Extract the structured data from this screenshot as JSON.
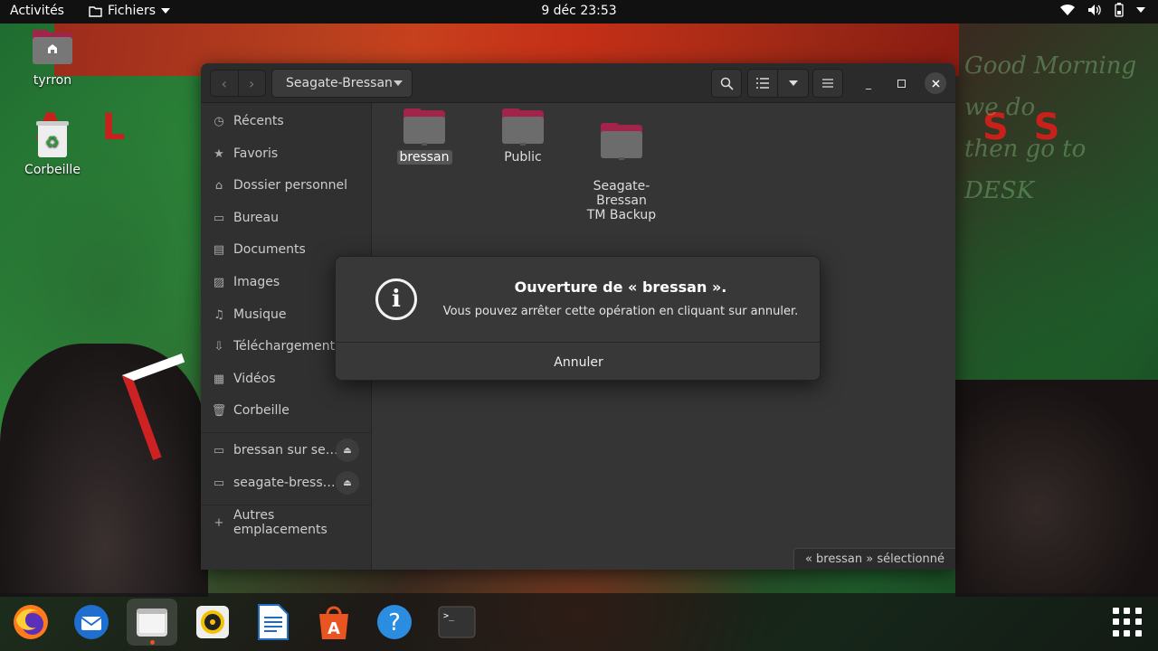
{
  "topbar": {
    "activities": "Activités",
    "app_menu": "Fichiers",
    "clock": "9 déc  23:53",
    "icons": [
      "wifi-icon",
      "volume-icon",
      "battery-icon",
      "system-menu-chevron-icon"
    ]
  },
  "desktop": {
    "icons": [
      {
        "label": "tyrron",
        "icon": "home-folder-icon"
      },
      {
        "label": "Corbeille",
        "icon": "trash-icon"
      }
    ]
  },
  "window": {
    "path": "Seagate-Bressan",
    "sidebar": {
      "items": [
        {
          "label": "Récents",
          "icon": "clock-icon"
        },
        {
          "label": "Favoris",
          "icon": "star-icon"
        },
        {
          "label": "Dossier personnel",
          "icon": "home-icon"
        },
        {
          "label": "Bureau",
          "icon": "desktop-icon"
        },
        {
          "label": "Documents",
          "icon": "document-icon"
        },
        {
          "label": "Images",
          "icon": "image-icon"
        },
        {
          "label": "Musique",
          "icon": "music-icon"
        },
        {
          "label": "Téléchargements",
          "icon": "download-icon"
        },
        {
          "label": "Vidéos",
          "icon": "video-icon"
        },
        {
          "label": "Corbeille",
          "icon": "trash-icon"
        }
      ],
      "mounts": [
        {
          "label": "bressan sur se…",
          "icon": "network-drive-icon"
        },
        {
          "label": "seagate-bress…",
          "icon": "network-drive-icon"
        }
      ],
      "other": "Autres emplacements"
    },
    "files": [
      {
        "name": "bressan",
        "selected": true
      },
      {
        "name": "Public",
        "selected": false
      },
      {
        "name": "Seagate-\nBressan\nTM Backup",
        "selected": false
      }
    ],
    "status": "« bressan » sélectionné"
  },
  "dialog": {
    "title": "Ouverture de « bressan ».",
    "message": "Vous pouvez arrêter cette opération en cliquant sur annuler.",
    "cancel": "Annuler"
  },
  "dock": {
    "apps": [
      "firefox-icon",
      "thunderbird-icon",
      "files-icon",
      "rhythmbox-icon",
      "libreoffice-writer-icon",
      "ubuntu-software-icon",
      "help-icon",
      "terminal-icon"
    ],
    "show_apps": "show-applications-icon"
  },
  "colors": {
    "accent": "#e95420",
    "folder": "#a3244a"
  }
}
